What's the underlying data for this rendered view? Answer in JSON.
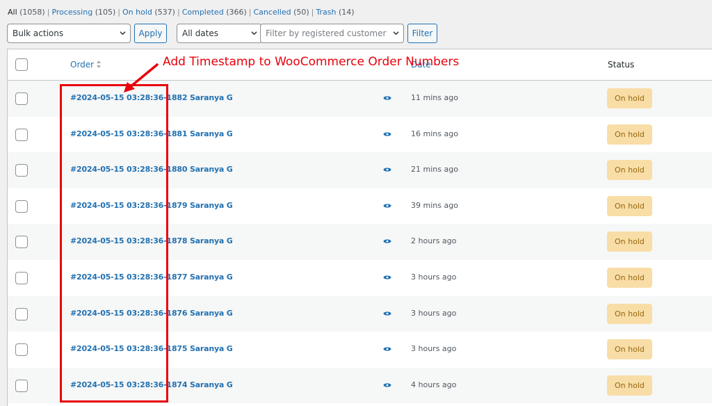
{
  "filters": {
    "all_label": "All",
    "all_count": "(1058)",
    "processing_label": "Processing",
    "processing_count": "(105)",
    "onhold_label": "On hold",
    "onhold_count": "(537)",
    "completed_label": "Completed",
    "completed_count": "(366)",
    "cancelled_label": "Cancelled",
    "cancelled_count": "(50)",
    "trash_label": "Trash",
    "trash_count": "(14)",
    "separator": "|"
  },
  "toolbar": {
    "bulk_actions": "Bulk actions",
    "apply": "Apply",
    "all_dates": "All dates",
    "customer_placeholder": "Filter by registered customer",
    "filter": "Filter"
  },
  "table": {
    "col_order": "Order",
    "col_date": "Date",
    "col_status": "Status",
    "rows": [
      {
        "order": "#2024-05-15 03:28:36-1882 Saranya G",
        "date": "11 mins ago",
        "status": "On hold"
      },
      {
        "order": "#2024-05-15 03:28:36-1881 Saranya G",
        "date": "16 mins ago",
        "status": "On hold"
      },
      {
        "order": "#2024-05-15 03:28:36-1880 Saranya G",
        "date": "21 mins ago",
        "status": "On hold"
      },
      {
        "order": "#2024-05-15 03:28:36-1879 Saranya G",
        "date": "39 mins ago",
        "status": "On hold"
      },
      {
        "order": "#2024-05-15 03:28:36-1878 Saranya G",
        "date": "2 hours ago",
        "status": "On hold"
      },
      {
        "order": "#2024-05-15 03:28:36-1877 Saranya G",
        "date": "3 hours ago",
        "status": "On hold"
      },
      {
        "order": "#2024-05-15 03:28:36-1876 Saranya G",
        "date": "3 hours ago",
        "status": "On hold"
      },
      {
        "order": "#2024-05-15 03:28:36-1875 Saranya G",
        "date": "3 hours ago",
        "status": "On hold"
      },
      {
        "order": "#2024-05-15 03:28:36-1874 Saranya G",
        "date": "4 hours ago",
        "status": "On hold"
      }
    ]
  },
  "annotation": {
    "text": "Add Timestamp to WooCommerce Order Numbers",
    "color": "#e8000b"
  },
  "colors": {
    "link": "#2271b1",
    "onhold_bg": "#f8dda7",
    "onhold_text": "#94660c"
  },
  "icons": {
    "preview": "eye-icon",
    "sort": "sort-arrows-icon",
    "select": "chevron-down-icon"
  }
}
